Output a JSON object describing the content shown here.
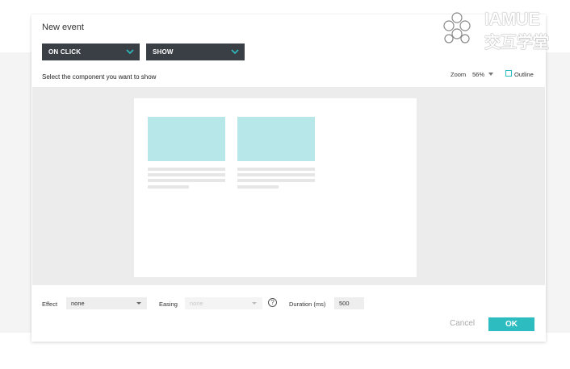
{
  "dialog": {
    "title": "New event",
    "trigger": "ON CLICK",
    "action": "SHOW",
    "instruction": "Select the component you want to show"
  },
  "zoom": {
    "label": "Zoom",
    "value": "56%"
  },
  "outline": {
    "label": "Outline",
    "checked": false
  },
  "footer": {
    "effect_label": "Effect",
    "effect_value": "none",
    "easing_label": "Easing",
    "easing_value": "none",
    "help_glyph": "?",
    "duration_label": "Duration (ms)",
    "duration_value": "500",
    "cancel_label": "Cancel",
    "ok_label": "OK"
  },
  "watermark": {
    "en": "IAMUE",
    "cn": "交互学堂"
  },
  "colors": {
    "accent": "#2dbcc0",
    "dropdown_bg": "#3a3f45",
    "placeholder": "#b7e7e8"
  }
}
